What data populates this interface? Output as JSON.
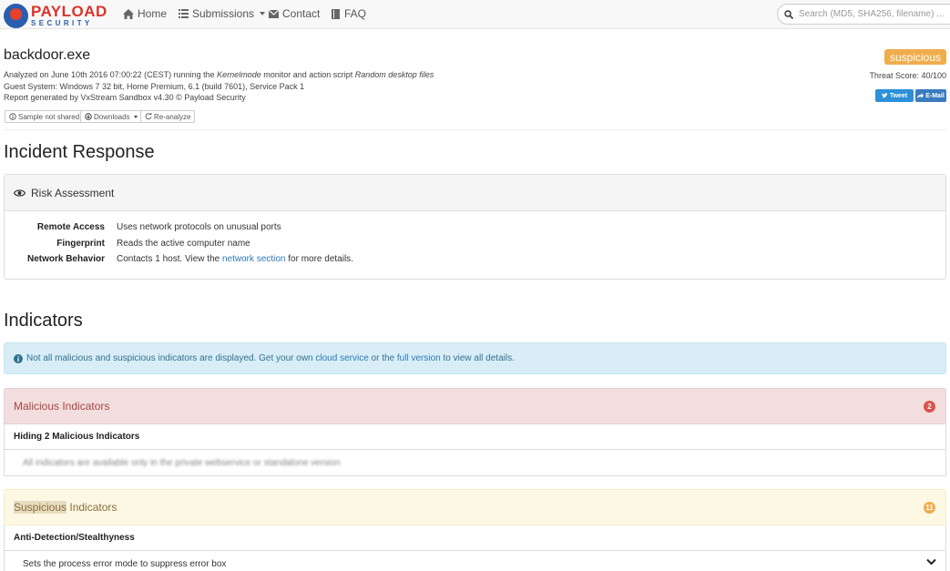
{
  "brand": {
    "line1": "PAYLOAD",
    "line2": "SECURITY"
  },
  "nav": {
    "home": "Home",
    "submissions": "Submissions",
    "contact": "Contact",
    "faq": "FAQ",
    "search_placeholder": "Search (MD5, SHA256, filename) ..."
  },
  "report": {
    "file_name": "backdoor.exe",
    "analysis_prefix": "Analyzed on June 10th 2016 07:00:22 (CEST) running the ",
    "monitor_name": "Kernelmode",
    "analysis_middle": " monitor and action script ",
    "action_script": "Random desktop files",
    "guest_system": "Guest System: Windows 7 32 bit, Home Premium, 6.1 (build 7601), Service Pack 1",
    "generated_by": "Report generated by VxStream Sandbox v4.30 © Payload Security",
    "verdict": "suspicious",
    "threat_score": "Threat Score: 40/100",
    "tweet": "Tweet",
    "email": "E-Mail",
    "sample_not_shared": "Sample not shared",
    "downloads": "Downloads",
    "reanalyze": "Re-analyze"
  },
  "incident": {
    "heading": "Incident Response",
    "panel_title": "Risk Assessment",
    "rows": [
      {
        "label": "Remote Access",
        "value": "Uses network protocols on unusual ports"
      },
      {
        "label": "Fingerprint",
        "value": "Reads the active computer name"
      },
      {
        "label": "Network Behavior",
        "value_prefix": "Contacts 1 host. View the ",
        "link": "network section",
        "value_suffix": " for more details."
      }
    ]
  },
  "indicators": {
    "heading": "Indicators",
    "notice_prefix": "Not all malicious and suspicious indicators are displayed. Get your own ",
    "notice_link1": "cloud service",
    "notice_middle": " or the ",
    "notice_link2": "full version",
    "notice_suffix": " to view all details.",
    "malicious": {
      "title": "Malicious Indicators",
      "count": "2",
      "sub": "Hiding 2 Malicious Indicators",
      "note": "All indicators are available only in the private webservice or standalone version"
    },
    "suspicious": {
      "title_highlight": "Suspicious",
      "title_rest": " Indicators",
      "count": "11",
      "sub": "Anti-Detection/Stealthyness",
      "item": "Sets the process error mode to suppress error box"
    }
  },
  "colors": {
    "verdict_badge": "#f0ad4e",
    "malicious_bg": "#f2dede",
    "suspicious_bg": "#fcf8e3",
    "info_bg": "#d9edf7",
    "link": "#2a7ab8"
  },
  "icons": [
    "home-icon",
    "list-icon",
    "envelope-icon",
    "book-icon",
    "search-icon",
    "twitter-icon",
    "share-icon",
    "eye-icon",
    "info-icon",
    "chevron-down-icon",
    "download-icon",
    "refresh-icon"
  ]
}
